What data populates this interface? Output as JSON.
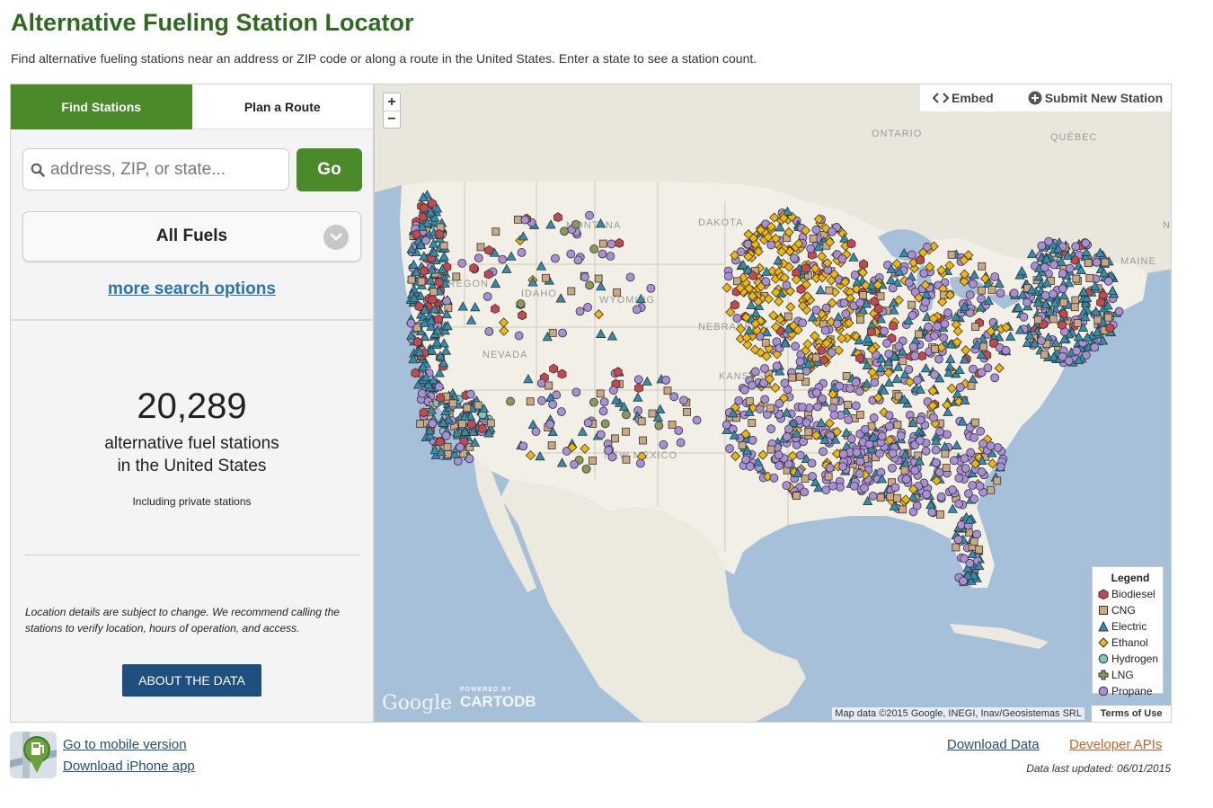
{
  "header": {
    "title": "Alternative Fueling Station Locator",
    "subtitle": "Find alternative fueling stations near an address or ZIP code or along a route in the United States. Enter a state to see a station count."
  },
  "tabs": [
    {
      "label": "Find Stations",
      "active": true
    },
    {
      "label": "Plan a Route",
      "active": false
    }
  ],
  "search": {
    "placeholder": "address, ZIP, or state...",
    "value": "",
    "go_label": "Go"
  },
  "fuel_select": {
    "selected": "All Fuels"
  },
  "more_options_label": "more search options",
  "station_count": {
    "number": "20,289",
    "label_line1": "alternative fuel stations",
    "label_line2": "in the United States",
    "note": "Including private stations"
  },
  "disclaimer": "Location details are subject to change. We recommend calling the stations to verify location, hours of operation, and access.",
  "about_button": "ABOUT THE DATA",
  "map": {
    "actions": {
      "embed": "Embed",
      "submit": "Submit New Station"
    },
    "zoom_in": "+",
    "zoom_out": "−",
    "place_labels": [
      "ONTARIO",
      "QUÉBEC",
      "MONTANA",
      "DAKOTA",
      "OREGON",
      "IDAHO",
      "WYOMING",
      "NEBRASKA",
      "NEVADA",
      "KANSAS",
      "NEW MEXICO",
      "MAINE",
      "N"
    ],
    "google_logo": "Google",
    "cartodb_powered": "POWERED BY",
    "cartodb_name": "CARTODB",
    "attribution": "Map data ©2015 Google, INEGI, Inav/Geosistemas SRL",
    "terms": "Terms of Use",
    "legend": {
      "title": "Legend",
      "items": [
        {
          "label": "Biodiesel",
          "shape": "hexagon",
          "color": "#c8474e"
        },
        {
          "label": "CNG",
          "shape": "square",
          "color": "#c9a882"
        },
        {
          "label": "Electric",
          "shape": "triangle",
          "color": "#2e8fb0"
        },
        {
          "label": "Ethanol",
          "shape": "diamond",
          "color": "#f2b705"
        },
        {
          "label": "Hydrogen",
          "shape": "circle",
          "color": "#7ac3c9"
        },
        {
          "label": "LNG",
          "shape": "cross",
          "color": "#8a9a5b"
        },
        {
          "label": "Propane",
          "shape": "circle",
          "color": "#a98ed8"
        }
      ]
    }
  },
  "footer": {
    "mobile_link": "Go to mobile version",
    "iphone_link": "Download iPhone app",
    "download_data": "Download Data",
    "developer_apis": "Developer APIs",
    "updated": "Data last updated: 06/01/2015"
  }
}
